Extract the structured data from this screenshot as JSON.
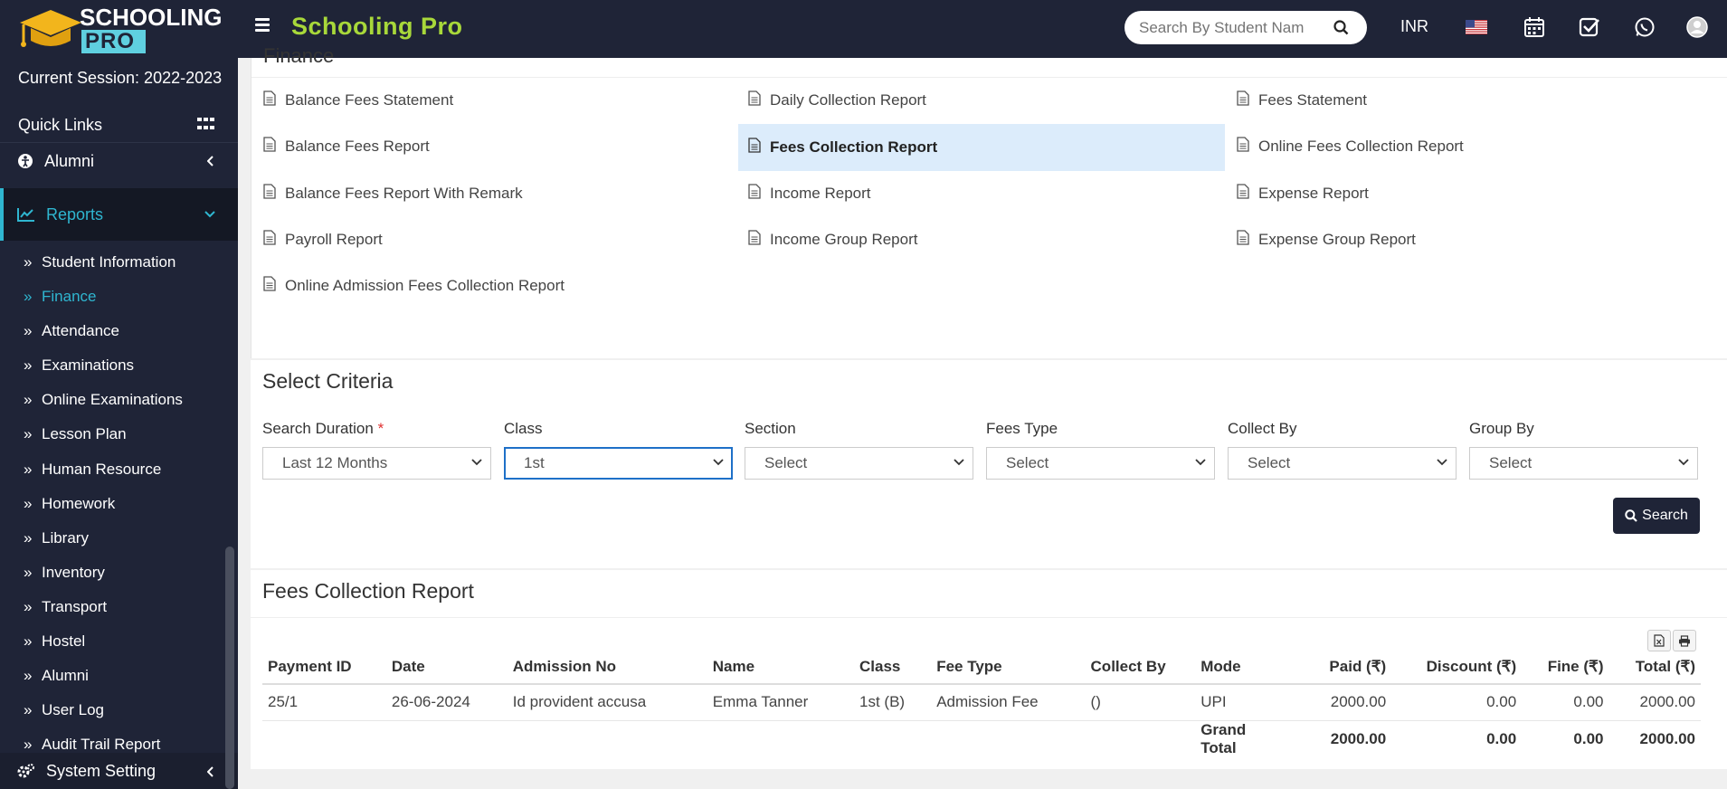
{
  "logo": {
    "line1": "SCHOOLING",
    "line2": "PRO"
  },
  "header": {
    "title": "Schooling Pro",
    "search_placeholder": "Search By Student Nam",
    "currency": "INR"
  },
  "sidebar": {
    "session": "Current Session: 2022-2023",
    "quick_links": "Quick Links",
    "alumni_menu": "Alumni",
    "reports_menu": "Reports",
    "report_items": [
      "Student Information",
      "Finance",
      "Attendance",
      "Examinations",
      "Online Examinations",
      "Lesson Plan",
      "Human Resource",
      "Homework",
      "Library",
      "Inventory",
      "Transport",
      "Hostel",
      "Alumni",
      "User Log",
      "Audit Trail Report"
    ],
    "active_item": "Finance",
    "system_setting": "System Setting"
  },
  "finance": {
    "section_title": "Finance",
    "links": [
      [
        "Balance Fees Statement",
        "Daily Collection Report",
        "Fees Statement"
      ],
      [
        "Balance Fees Report",
        "Fees Collection Report",
        "Online Fees Collection Report"
      ],
      [
        "Balance Fees Report With Remark",
        "Income Report",
        "Expense Report"
      ],
      [
        "Payroll Report",
        "Income Group Report",
        "Expense Group Report"
      ],
      [
        "Online Admission Fees Collection Report",
        "",
        ""
      ]
    ],
    "active_link": "Fees Collection Report"
  },
  "criteria": {
    "title": "Select Criteria",
    "fields": [
      {
        "label": "Search Duration",
        "required": "*",
        "value": "Last 12 Months"
      },
      {
        "label": "Class",
        "value": "1st"
      },
      {
        "label": "Section",
        "value": "Select"
      },
      {
        "label": "Fees Type",
        "value": "Select"
      },
      {
        "label": "Collect By",
        "value": "Select"
      },
      {
        "label": "Group By",
        "value": "Select"
      }
    ],
    "search_button": "Search"
  },
  "report": {
    "title": "Fees Collection Report",
    "columns": [
      "Payment ID",
      "Date",
      "Admission No",
      "Name",
      "Class",
      "Fee Type",
      "Collect By",
      "Mode",
      "Paid (₹)",
      "Discount (₹)",
      "Fine (₹)",
      "Total (₹)"
    ],
    "rows": [
      [
        "25/1",
        "26-06-2024",
        "Id provident accusa",
        "Emma Tanner",
        "1st (B)",
        "Admission Fee",
        "()",
        "UPI",
        "2000.00",
        "0.00",
        "0.00",
        "2000.00"
      ]
    ],
    "grand_total": {
      "label": "Grand Total",
      "paid": "2000.00",
      "discount": "0.00",
      "fine": "0.00",
      "total": "2000.00"
    }
  },
  "colors": {
    "nav_bg": "#1f2437",
    "brand_green": "#a8d83a",
    "accent_cyan": "#2fb6d0",
    "active_link_bg": "#dcecfb"
  },
  "icons": {
    "header": [
      "menu-icon",
      "search-icon",
      "us-flag-icon",
      "calendar-icon",
      "checkbox-icon",
      "whatsapp-icon",
      "user-avatar-icon"
    ],
    "sidebar": [
      "grid-icon",
      "alumni-icon",
      "chart-line-icon",
      "double-chevron-right-icon",
      "cogs-icon"
    ],
    "links": "file-text-icon",
    "table": [
      "excel-export-icon",
      "print-icon"
    ]
  }
}
